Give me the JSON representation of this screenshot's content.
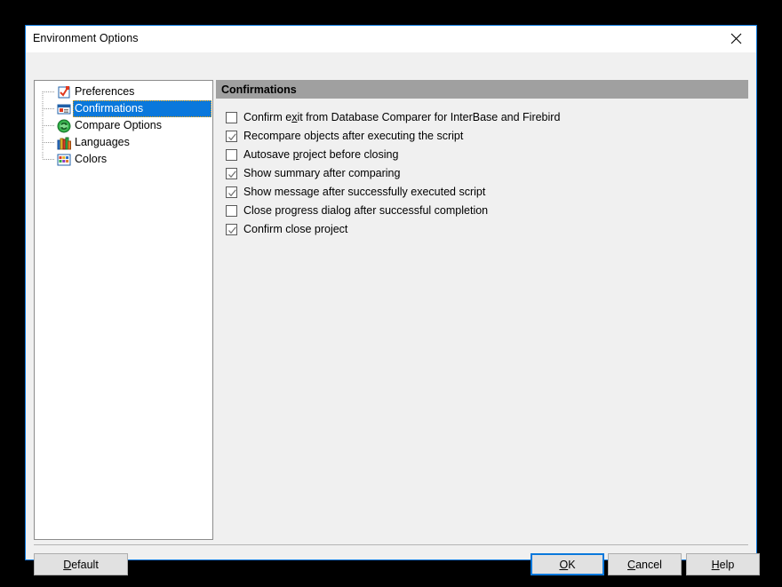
{
  "window": {
    "title": "Environment Options",
    "close_icon": "close-icon",
    "accent_color": "#0a78dc",
    "background": "#f0f0f0",
    "header_color": "#a0a0a0"
  },
  "tree": {
    "items": [
      {
        "label": "Preferences",
        "icon": "preferences-checkbox-icon",
        "selected": false
      },
      {
        "label": "Confirmations",
        "icon": "confirmations-dialog-icon",
        "selected": true
      },
      {
        "label": "Compare Options",
        "icon": "compare-options-refresh-icon",
        "selected": false
      },
      {
        "label": "Languages",
        "icon": "languages-books-icon",
        "selected": false
      },
      {
        "label": "Colors",
        "icon": "colors-palette-grid-icon",
        "selected": false
      }
    ]
  },
  "content": {
    "section_title": "Confirmations",
    "options": [
      {
        "label_before": "Confirm e",
        "accel": "x",
        "label_after": "it from Database Comparer for InterBase and Firebird",
        "checked": false
      },
      {
        "label_before": "Recompare objects after executing the script",
        "accel": "",
        "label_after": "",
        "checked": true
      },
      {
        "label_before": "Autosave ",
        "accel": "p",
        "label_after": "roject before closing",
        "checked": false
      },
      {
        "label_before": "Show summary after comparing",
        "accel": "",
        "label_after": "",
        "checked": true
      },
      {
        "label_before": "Show message after successfully executed script",
        "accel": "",
        "label_after": "",
        "checked": true
      },
      {
        "label_before": "Close progress dialog after successful completion",
        "accel": "",
        "label_after": "",
        "checked": false
      },
      {
        "label_before": "Confirm close project",
        "accel": "",
        "label_after": "",
        "checked": true
      }
    ]
  },
  "buttons": {
    "default": {
      "before": "",
      "accel": "D",
      "after": "efault"
    },
    "ok": {
      "before": "",
      "accel": "O",
      "after": "K"
    },
    "cancel": {
      "before": "",
      "accel": "C",
      "after": "ancel"
    },
    "help": {
      "before": "",
      "accel": "H",
      "after": "elp"
    }
  }
}
